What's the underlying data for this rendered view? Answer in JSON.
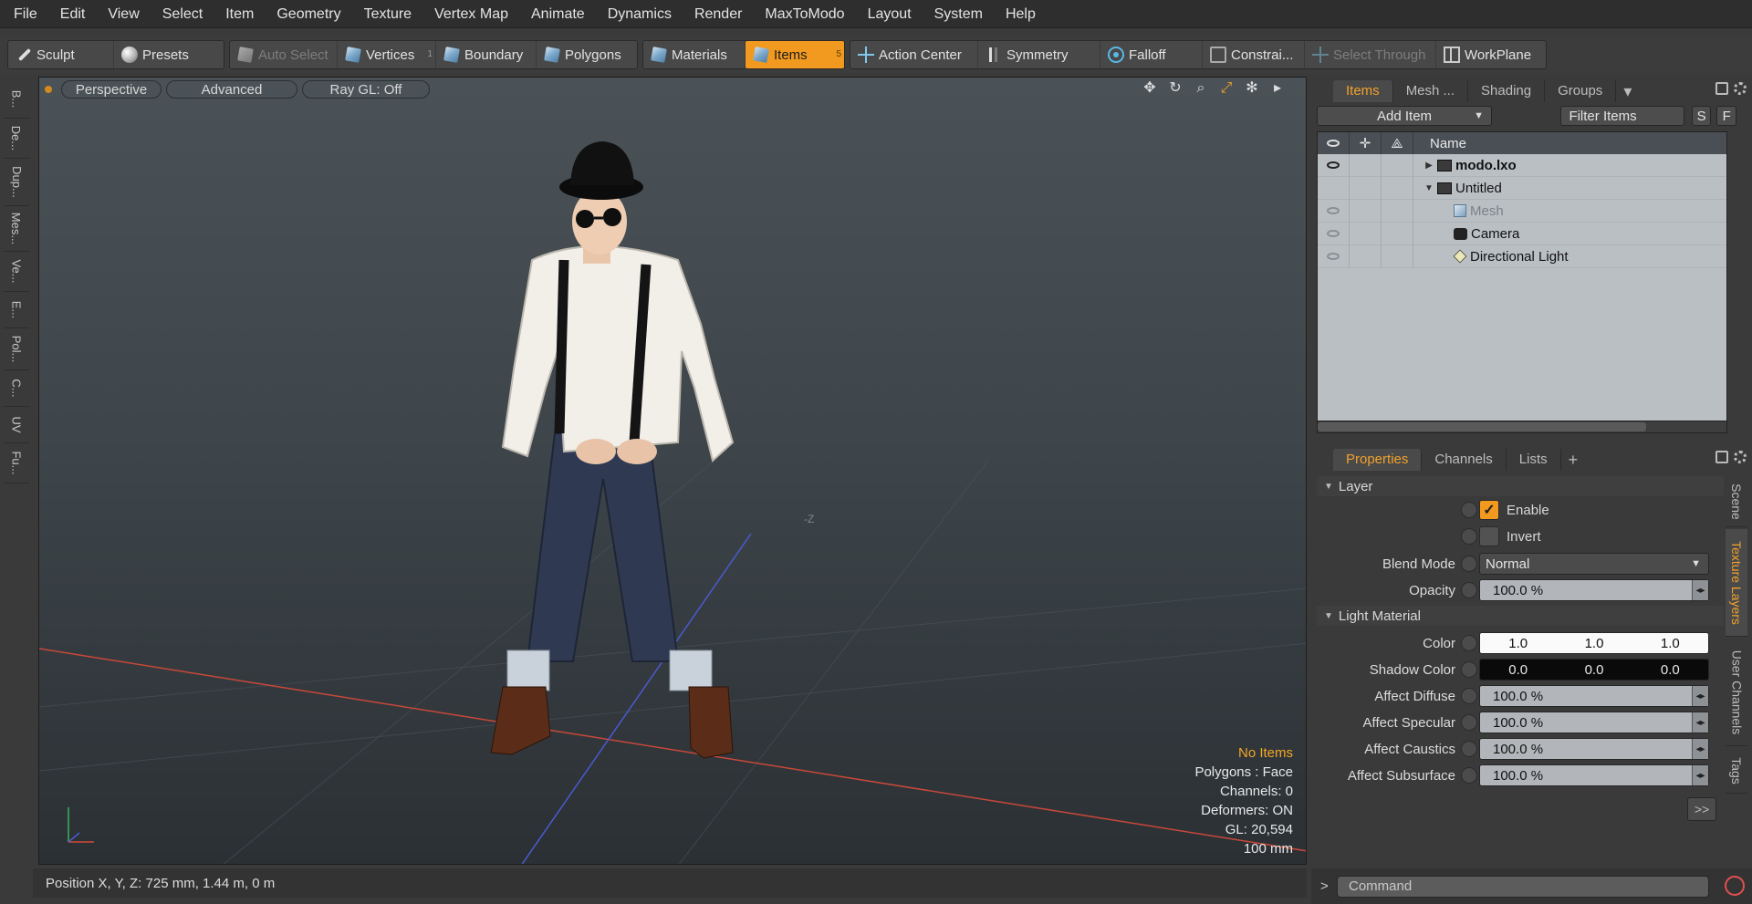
{
  "menu": [
    "File",
    "Edit",
    "View",
    "Select",
    "Item",
    "Geometry",
    "Texture",
    "Vertex Map",
    "Animate",
    "Dynamics",
    "Render",
    "MaxToModo",
    "Layout",
    "System",
    "Help"
  ],
  "toolbar": {
    "sculpt": "Sculpt",
    "presets": "Presets",
    "auto_select": "Auto Select",
    "vertices": "Vertices",
    "vertices_count": "1",
    "boundary": "Boundary",
    "polygons": "Polygons",
    "materials": "Materials",
    "items": "Items",
    "items_count": "5",
    "action_center": "Action Center",
    "symmetry": "Symmetry",
    "falloff": "Falloff",
    "constraints": "Constrai...",
    "select_through": "Select Through",
    "workplane": "WorkPlane"
  },
  "left_tabs": [
    "B...",
    "De...",
    "Dup...",
    "Mes...",
    "Ve...",
    "E...",
    "Pol...",
    "C...",
    "UV",
    "Fu..."
  ],
  "viewport": {
    "perspective": "Perspective",
    "advanced": "Advanced",
    "raygl": "Ray GL: Off",
    "z_label": "-Z",
    "stats": {
      "no_items": "No Items",
      "polygons": "Polygons : Face",
      "channels": "Channels: 0",
      "deformers": "Deformers: ON",
      "gl": "GL: 20,594",
      "scale": "100 mm"
    }
  },
  "status": {
    "position": "Position X, Y, Z:   725 mm, 1.44 m, 0 m"
  },
  "items_panel": {
    "tabs": [
      "Items",
      "Mesh ...",
      "Shading",
      "Groups"
    ],
    "add_item": "Add Item",
    "filter_items": "Filter Items",
    "btn_s": "S",
    "btn_f": "F",
    "name_header": "Name",
    "rows": [
      {
        "name": "modo.lxo",
        "bold": true
      },
      {
        "name": "Untitled",
        "bold": false
      },
      {
        "name": "Mesh",
        "bold": false
      },
      {
        "name": "Camera",
        "bold": false
      },
      {
        "name": "Directional Light",
        "bold": false
      }
    ]
  },
  "props_panel": {
    "tabs": [
      "Properties",
      "Channels",
      "Lists"
    ],
    "plus": "+",
    "section_layer": "Layer",
    "enable": "Enable",
    "invert": "Invert",
    "blend_mode_label": "Blend Mode",
    "blend_mode_value": "Normal",
    "opacity_label": "Opacity",
    "opacity_value": "100.0 %",
    "section_light": "Light Material",
    "color_label": "Color",
    "color_values": [
      "1.0",
      "1.0",
      "1.0"
    ],
    "shadow_label": "Shadow Color",
    "shadow_values": [
      "0.0",
      "0.0",
      "0.0"
    ],
    "affect_diffuse_label": "Affect Diffuse",
    "affect_diffuse_value": "100.0 %",
    "affect_specular_label": "Affect Specular",
    "affect_specular_value": "100.0 %",
    "affect_caustics_label": "Affect Caustics",
    "affect_caustics_value": "100.0 %",
    "affect_subsurface_label": "Affect Subsurface",
    "affect_subsurface_value": "100.0 %",
    "more": ">>"
  },
  "side_tabs": [
    "Scene",
    "Texture Layers",
    "User Channels",
    "Tags"
  ],
  "command": {
    "placeholder": "Command",
    "prompt": ">"
  },
  "colors": {
    "accent": "#f29a1f",
    "x_axis": "#d44a3a",
    "z_axis": "#4a5bd0",
    "warn": "#f6a825"
  }
}
